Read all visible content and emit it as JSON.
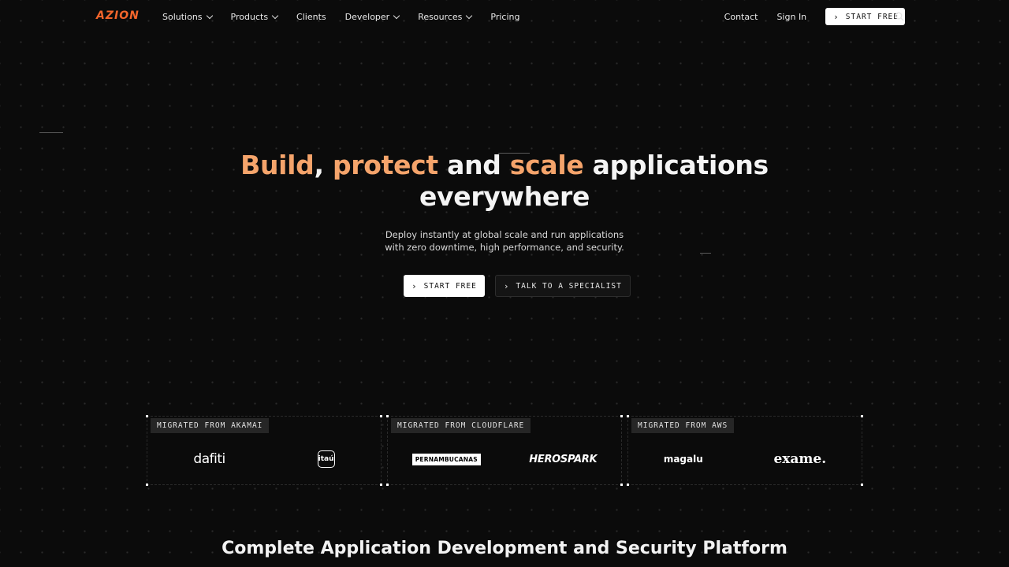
{
  "header": {
    "logo": "AZION",
    "nav": [
      {
        "label": "Solutions",
        "dropdown": true
      },
      {
        "label": "Products",
        "dropdown": true
      },
      {
        "label": "Clients",
        "dropdown": false
      },
      {
        "label": "Developer",
        "dropdown": true
      },
      {
        "label": "Resources",
        "dropdown": true
      },
      {
        "label": "Pricing",
        "dropdown": false
      }
    ],
    "contact": "Contact",
    "signin": "Sign In",
    "cta": "START FREE",
    "search_icon": "search-icon"
  },
  "hero": {
    "title_part1": "Build",
    "title_comma": ", ",
    "title_part2": "protect",
    "title_and": " and ",
    "title_part3": "scale",
    "title_rest": " applications",
    "title_line2": "everywhere",
    "subtitle_line1": "Deploy instantly at global scale and run applications",
    "subtitle_line2": "with zero downtime, high performance, and security.",
    "primary_cta": "START FREE",
    "secondary_cta": "TALK TO A SPECIALIST"
  },
  "migrations": [
    {
      "tag": "MIGRATED FROM AKAMAI",
      "logos": [
        "dafiti",
        "itaú"
      ]
    },
    {
      "tag": "MIGRATED FROM CLOUDFLARE",
      "logos": [
        "PERNAMBUCANAS",
        "HEROSPARK"
      ]
    },
    {
      "tag": "MIGRATED FROM AWS",
      "logos": [
        "magalu",
        "exame."
      ]
    }
  ],
  "section_title": "Complete Application Development and Security Platform",
  "colors": {
    "brand": "#f3652b",
    "accent": "#f5a46b",
    "background": "#0b0b0b"
  }
}
